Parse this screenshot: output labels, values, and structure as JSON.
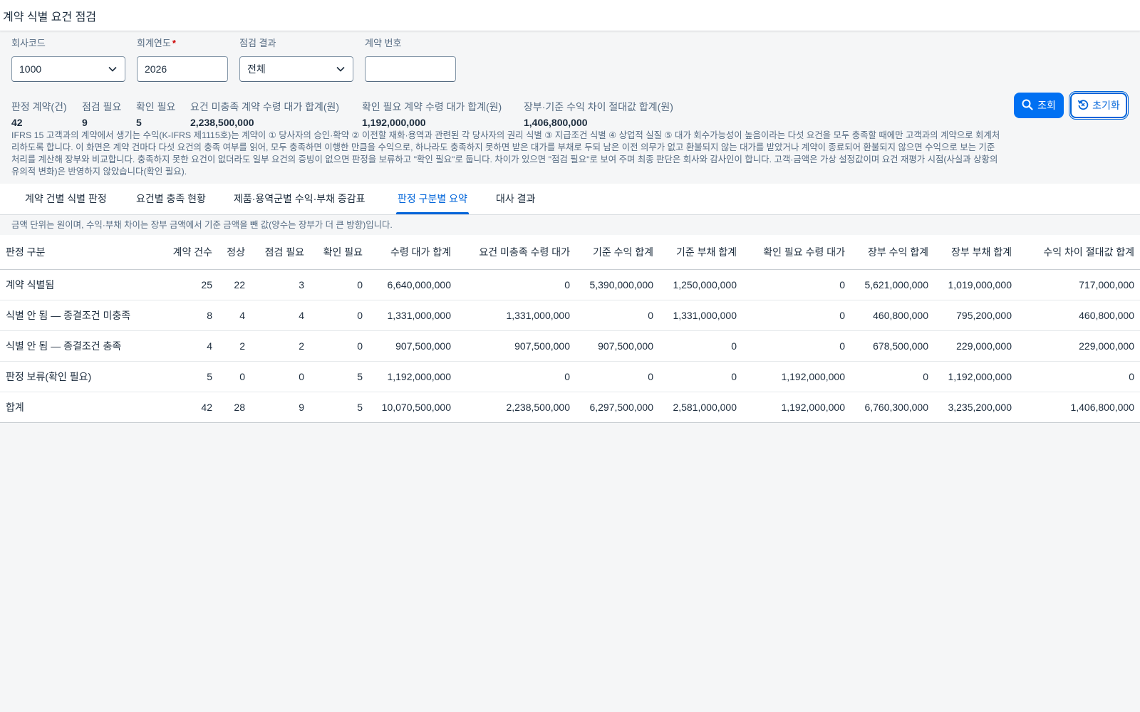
{
  "page": {
    "title": "계약 식별 요건 점검"
  },
  "filters": {
    "company_code": {
      "label": "회사코드",
      "value": "1000"
    },
    "fiscal_year": {
      "label": "회계연도",
      "required_mark": "*",
      "value": "2026"
    },
    "check_result": {
      "label": "점검 결과",
      "value": "전체"
    },
    "contract_no": {
      "label": "계약 번호",
      "value": ""
    }
  },
  "buttons": {
    "search": "조회",
    "reset": "초기화"
  },
  "icons": {
    "search": "search-icon",
    "reset": "reset-icon",
    "dropdown": "chevron-down-icon"
  },
  "kpis": [
    {
      "label": "판정 계약(건)",
      "value": "42"
    },
    {
      "label": "점검 필요",
      "value": "9"
    },
    {
      "label": "확인 필요",
      "value": "5"
    },
    {
      "label": "요건 미충족 계약 수령 대가 합계(원)",
      "value": "2,238,500,000"
    },
    {
      "label": "확인 필요 계약 수령 대가 합계(원)",
      "value": "1,192,000,000"
    },
    {
      "label": "장부·기준 수익 차이 절대값 합계(원)",
      "value": "1,406,800,000"
    }
  ],
  "description": [
    "IFRS 15 고객과의 계약에서 생기는 수익(K-IFRS 제1115호)는 계약이 ① 당사자의 승인·확약 ② 이전할 재화·용역과 관련된 각 당사자의 권리 식별 ③ 지급조건 식별 ④ 상업적 실질 ⑤ 대가 회수가능성이 높음이라는 다섯 요건을 모두 충족할 때에만 고객과의 계약으로 회계처",
    "리하도록 합니다. 이 화면은 계약 건마다 다섯 요건의 충족 여부를 읽어, 모두 충족하면 이행한 만큼을 수익으로, 하나라도 충족하지 못하면 받은 대가를 부채로 두되 남은 이전 의무가 없고 환불되지 않는 대가를 받았거나 계약이 종료되어 환불되지 않으면 수익으로 보는 기준",
    "처리를 계산해 장부와 비교합니다. 충족하지 못한 요건이 없더라도 일부 요건의 증빙이 없으면 판정을 보류하고 \"확인 필요\"로 둡니다. 차이가 있으면 \"점검 필요\"로 보여 주며 최종 판단은 회사와 감사인이 합니다. 고객·금액은 가상 설정값이며 요건 재평가 시점(사실과 상황의",
    "유의적 변화)은 반영하지 않았습니다(확인 필요)."
  ],
  "tabs": [
    {
      "label": "계약 건별 식별 판정",
      "active": false
    },
    {
      "label": "요건별 충족 현황",
      "active": false
    },
    {
      "label": "제품·용역군별 수익·부채 증감표",
      "active": false
    },
    {
      "label": "판정 구분별 요약",
      "active": true
    },
    {
      "label": "대사 결과",
      "active": false
    }
  ],
  "table_note": "금액 단위는 원이며, 수익·부채 차이는 장부 금액에서 기준 금액을 뺀 값(양수는 장부가 더 큰 방향)입니다.",
  "table": {
    "columns": [
      "판정 구분",
      "계약 건수",
      "정상",
      "점검 필요",
      "확인 필요",
      "수령 대가 합계",
      "요건 미충족 수령 대가",
      "기준 수익 합계",
      "기준 부채 합계",
      "확인 필요 수령 대가",
      "장부 수익 합계",
      "장부 부채 합계",
      "수익 차이 절대값 합계"
    ],
    "rows": [
      [
        "계약 식별됨",
        "25",
        "22",
        "3",
        "0",
        "6,640,000,000",
        "0",
        "5,390,000,000",
        "1,250,000,000",
        "0",
        "5,621,000,000",
        "1,019,000,000",
        "717,000,000"
      ],
      [
        "식별 안 됨 — 종결조건 미충족",
        "8",
        "4",
        "4",
        "0",
        "1,331,000,000",
        "1,331,000,000",
        "0",
        "1,331,000,000",
        "0",
        "460,800,000",
        "795,200,000",
        "460,800,000"
      ],
      [
        "식별 안 됨 — 종결조건 충족",
        "4",
        "2",
        "2",
        "0",
        "907,500,000",
        "907,500,000",
        "907,500,000",
        "0",
        "0",
        "678,500,000",
        "229,000,000",
        "229,000,000"
      ],
      [
        "판정 보류(확인 필요)",
        "5",
        "0",
        "0",
        "5",
        "1,192,000,000",
        "0",
        "0",
        "0",
        "1,192,000,000",
        "0",
        "1,192,000,000",
        "0"
      ],
      [
        "합계",
        "42",
        "28",
        "9",
        "5",
        "10,070,500,000",
        "2,238,500,000",
        "6,297,500,000",
        "2,581,000,000",
        "1,192,000,000",
        "6,760,300,000",
        "3,235,200,000",
        "1,406,800,000"
      ]
    ]
  },
  "colors": {
    "accent": "#0064d9",
    "primary_button": "#0070f2",
    "diff_highlight": "#c35500"
  }
}
